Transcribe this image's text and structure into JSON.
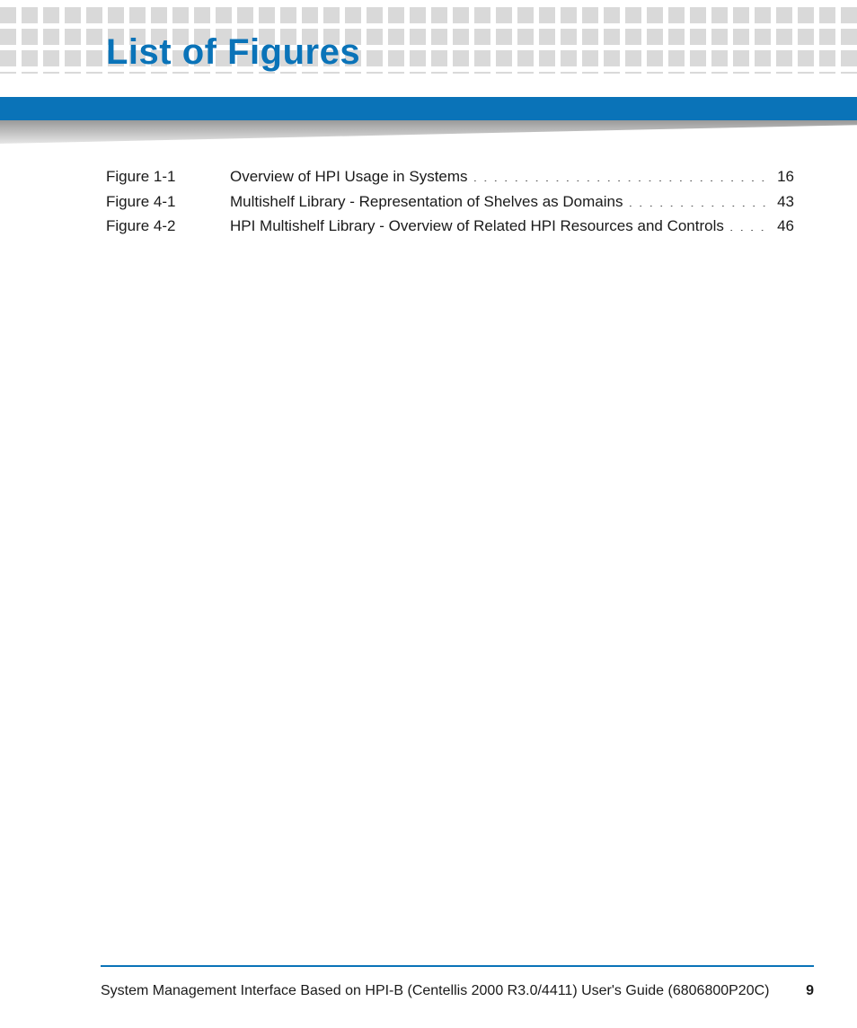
{
  "header": {
    "title": "List of Figures"
  },
  "figures": [
    {
      "label": "Figure 1-1",
      "title": "Overview of HPI Usage in Systems",
      "page": "16"
    },
    {
      "label": "Figure 4-1",
      "title": "Multishelf Library - Representation of Shelves as Domains",
      "page": "43"
    },
    {
      "label": "Figure 4-2",
      "title": "HPI Multishelf Library - Overview of Related HPI Resources and Controls",
      "page": "46"
    }
  ],
  "footer": {
    "text": "System Management Interface Based on HPI-B (Centellis 2000 R3.0/4411) User's Guide (6806800P20C)",
    "page": "9"
  }
}
